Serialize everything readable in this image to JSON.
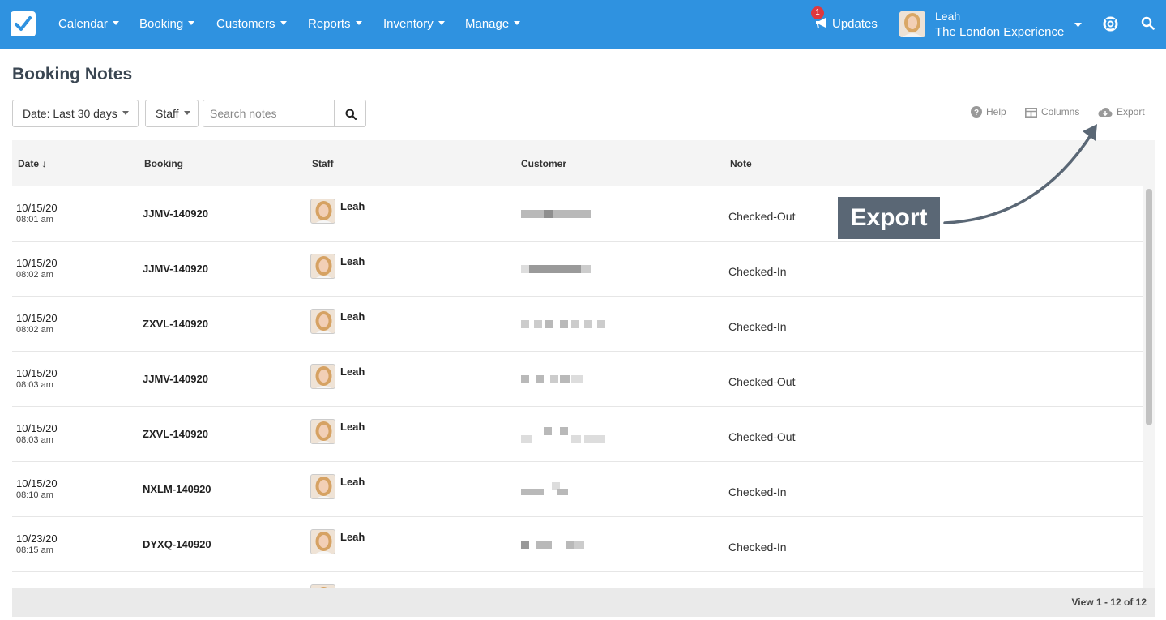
{
  "nav": {
    "items": [
      "Calendar",
      "Booking",
      "Customers",
      "Reports",
      "Inventory",
      "Manage"
    ],
    "updates_label": "Updates",
    "updates_badge": "1",
    "user_name": "Leah",
    "user_org": "The London Experience"
  },
  "page": {
    "title": "Booking Notes"
  },
  "filters": {
    "date_label": "Date: Last 30 days",
    "staff_label": "Staff",
    "search_placeholder": "Search notes"
  },
  "toolbar": {
    "help": "Help",
    "columns": "Columns",
    "export": "Export"
  },
  "table": {
    "headers": {
      "date": "Date ↓",
      "booking": "Booking",
      "staff": "Staff",
      "customer": "Customer",
      "note": "Note"
    },
    "rows": [
      {
        "date": "10/15/20",
        "time": "08:01 am",
        "booking": "JJMV-140920",
        "staff": "Leah",
        "note": "Checked-Out"
      },
      {
        "date": "10/15/20",
        "time": "08:02 am",
        "booking": "JJMV-140920",
        "staff": "Leah",
        "note": "Checked-In"
      },
      {
        "date": "10/15/20",
        "time": "08:02 am",
        "booking": "ZXVL-140920",
        "staff": "Leah",
        "note": "Checked-In"
      },
      {
        "date": "10/15/20",
        "time": "08:03 am",
        "booking": "JJMV-140920",
        "staff": "Leah",
        "note": "Checked-Out"
      },
      {
        "date": "10/15/20",
        "time": "08:03 am",
        "booking": "ZXVL-140920",
        "staff": "Leah",
        "note": "Checked-Out"
      },
      {
        "date": "10/15/20",
        "time": "08:10 am",
        "booking": "NXLM-140920",
        "staff": "Leah",
        "note": "Checked-In"
      },
      {
        "date": "10/23/20",
        "time": "08:15 am",
        "booking": "DYXQ-140920",
        "staff": "Leah",
        "note": "Checked-In"
      }
    ]
  },
  "pager": {
    "text": "View 1 - 12 of 12"
  },
  "annotation": {
    "label": "Export"
  },
  "colors": {
    "nav_bg": "#2f92e0",
    "callout_bg": "#5a6775",
    "badge": "#e0383e"
  }
}
